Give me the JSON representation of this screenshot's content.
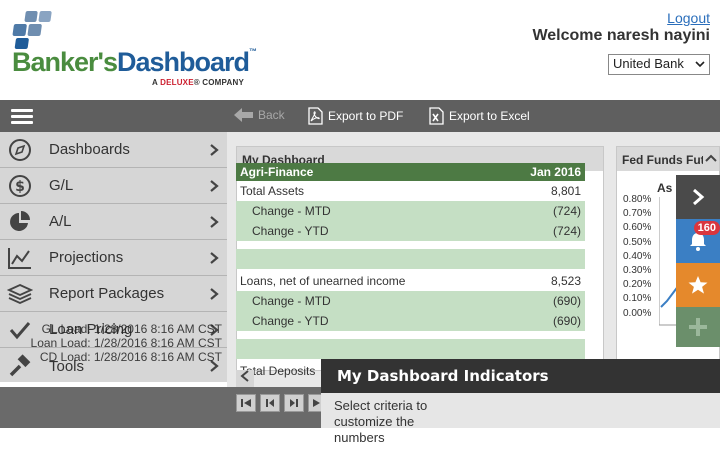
{
  "header": {
    "logo_part1": "Banker's",
    "logo_part2": "Dashboard",
    "logo_tm": "™",
    "logo_sub_prefix": "A ",
    "logo_sub_brand": "DELUXE",
    "logo_sub_suffix": "® COMPANY",
    "logout": "Logout",
    "welcome": "Welcome  naresh nayini",
    "bank_selected": "United Bank"
  },
  "toolbar": {
    "back": "Back",
    "export_pdf": "Export to PDF",
    "export_excel": "Export to Excel"
  },
  "sidebar": {
    "items": [
      {
        "label": "Dashboards",
        "icon": "compass-icon"
      },
      {
        "label": "G/L",
        "icon": "dollar-icon"
      },
      {
        "label": "A/L",
        "icon": "pie-chart-icon"
      },
      {
        "label": "Projections",
        "icon": "line-chart-icon"
      },
      {
        "label": "Report Packages",
        "icon": "layers-icon"
      },
      {
        "label": "Loan Pricing",
        "icon": "check-icon"
      },
      {
        "label": "Tools",
        "icon": "hammer-icon"
      }
    ],
    "load_info": [
      "GL Load: 1/28/2016 8:16 AM CST",
      "Loan Load: 1/28/2016 8:16 AM CST",
      "CD Load: 1/28/2016 8:16 AM CST"
    ]
  },
  "dashboard": {
    "title": "My Dashboard",
    "table_header": {
      "name": "Agri-Finance",
      "period": "Jan 2016"
    },
    "rows": [
      {
        "label": "Total Assets",
        "value": "8,801",
        "type": "main"
      },
      {
        "label": "Change - MTD",
        "value": "(724)",
        "type": "sub"
      },
      {
        "label": "Change - YTD",
        "value": "(724)",
        "type": "sub"
      },
      {
        "label": "",
        "value": "",
        "type": "spacer"
      },
      {
        "label": "Loans, net of unearned income",
        "value": "8,523",
        "type": "main"
      },
      {
        "label": "Change - MTD",
        "value": "(690)",
        "type": "sub"
      },
      {
        "label": "Change - YTD",
        "value": "(690)",
        "type": "sub"
      },
      {
        "label": "",
        "value": "",
        "type": "spacer"
      },
      {
        "label": "Total Deposits",
        "value": "",
        "type": "main"
      }
    ]
  },
  "fed_panel": {
    "title": "Fed Funds Fut",
    "as_of": "As o",
    "y_ticks": [
      "0.80%",
      "0.70%",
      "0.60%",
      "0.50%",
      "0.40%",
      "0.30%",
      "0.20%",
      "0.10%",
      "0.00%"
    ]
  },
  "rail": {
    "badge_count": "160"
  },
  "tooltip": {
    "title": "My Dashboard Indicators",
    "body": "Select criteria to customize the numbers"
  },
  "colors": {
    "green_brand": "#4a8c3f",
    "blue_brand": "#1f5c99",
    "table_header": "#4d7a44",
    "table_sub": "#c5dfc4",
    "rail_blue": "#3b7fc4",
    "rail_orange": "#e5892c",
    "rail_green": "#6b8f6b",
    "badge_red": "#d9363e"
  }
}
